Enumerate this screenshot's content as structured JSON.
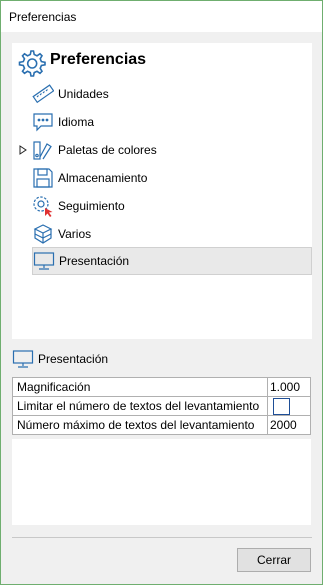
{
  "window": {
    "title": "Preferencias"
  },
  "tree": {
    "header": {
      "label": "Preferencias",
      "icon": "gear-icon"
    },
    "items": [
      {
        "label": "Unidades",
        "icon": "ruler-icon"
      },
      {
        "label": "Idioma",
        "icon": "speech-bubble-icon"
      },
      {
        "label": "Paletas de colores",
        "icon": "color-swatches-icon",
        "expandable": true
      },
      {
        "label": "Almacenamiento",
        "icon": "floppy-disk-icon"
      },
      {
        "label": "Seguimiento",
        "icon": "tracking-icon"
      },
      {
        "label": "Varios",
        "icon": "boxes-icon"
      },
      {
        "label": "Presentación",
        "icon": "monitor-icon",
        "selected": true
      }
    ]
  },
  "properties": {
    "title": "Presentación",
    "icon": "monitor-icon",
    "rows": [
      {
        "name": "Magnificación",
        "value": "1.000"
      },
      {
        "name": "Limitar el número de textos del levantamiento",
        "value": "",
        "type": "checkbox",
        "checked": false
      },
      {
        "name": "Número máximo de textos del levantamiento",
        "value": "2000"
      }
    ]
  },
  "buttons": {
    "close": "Cerrar"
  },
  "colors": {
    "window_border": "#6fae6f",
    "selection": "#e9e9e9",
    "checkbox_border": "#1e4e96"
  }
}
